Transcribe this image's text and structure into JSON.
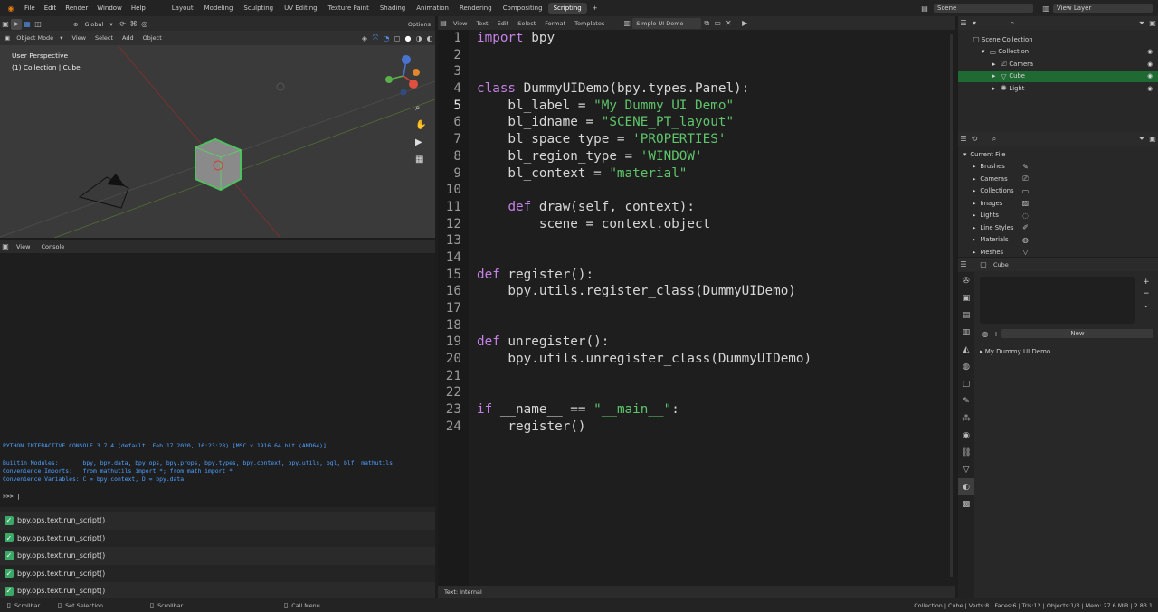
{
  "topbar": {
    "menus": [
      "File",
      "Edit",
      "Render",
      "Window",
      "Help"
    ],
    "workspaces": [
      "Layout",
      "Modeling",
      "Sculpting",
      "UV Editing",
      "Texture Paint",
      "Shading",
      "Animation",
      "Rendering",
      "Compositing",
      "Scripting"
    ],
    "active_workspace": "Scripting",
    "scene": "Scene",
    "view_layer": "View Layer"
  },
  "viewport": {
    "transform": "Global",
    "options": "Options",
    "mode": "Object Mode",
    "menus": [
      "View",
      "Select",
      "Add",
      "Object"
    ],
    "perspective": "User Perspective",
    "collection_info": "(1) Collection | Cube",
    "gizmo": {
      "x": "X",
      "y": "Y",
      "z": "Z"
    }
  },
  "console": {
    "menus": [
      "View",
      "Console"
    ],
    "banner": "PYTHON INTERACTIVE CONSOLE 3.7.4 (default, Feb 17 2020, 16:23:28) [MSC v.1916 64 bit (AMD64)]",
    "builtin": "Builtin Modules:       bpy, bpy.data, bpy.ops, bpy.props, bpy.types, bpy.context, bpy.utils, bgl, blf, mathutils",
    "imports": "Convenience Imports:   from mathutils import *; from math import *",
    "variables": "Convenience Variables: C = bpy.context, D = bpy.data",
    "prompt": ">>> "
  },
  "info_log": [
    "bpy.ops.text.run_script()",
    "bpy.ops.text.run_script()",
    "bpy.ops.text.run_script()",
    "bpy.ops.text.run_script()",
    "bpy.ops.text.run_script()"
  ],
  "text_editor": {
    "menus": [
      "View",
      "Text",
      "Edit",
      "Select",
      "Format",
      "Templates"
    ],
    "file_name": "Simple UI Demo",
    "footer": "Text: Internal",
    "current_line": 5,
    "lines": [
      [
        {
          "t": "import",
          "c": "kw"
        },
        {
          "t": " bpy"
        }
      ],
      [],
      [],
      [
        {
          "t": "class",
          "c": "kw"
        },
        {
          "t": " DummyUIDemo(bpy.types.Panel):"
        }
      ],
      [
        {
          "t": "    bl_label = "
        },
        {
          "t": "\"My Dummy UI Demo\"",
          "c": "str"
        }
      ],
      [
        {
          "t": "    bl_idname = "
        },
        {
          "t": "\"SCENE_PT_layout\"",
          "c": "str"
        }
      ],
      [
        {
          "t": "    bl_space_type = "
        },
        {
          "t": "'PROPERTIES'",
          "c": "str"
        }
      ],
      [
        {
          "t": "    bl_region_type = "
        },
        {
          "t": "'WINDOW'",
          "c": "str"
        }
      ],
      [
        {
          "t": "    bl_context = "
        },
        {
          "t": "\"material\"",
          "c": "str"
        }
      ],
      [],
      [
        {
          "t": "    "
        },
        {
          "t": "def",
          "c": "kw"
        },
        {
          "t": " draw(self, context):"
        }
      ],
      [
        {
          "t": "        scene = context.object"
        }
      ],
      [],
      [],
      [
        {
          "t": "def",
          "c": "kw"
        },
        {
          "t": " register():"
        }
      ],
      [
        {
          "t": "    bpy.utils.register_class(DummyUIDemo)"
        }
      ],
      [],
      [],
      [
        {
          "t": "def",
          "c": "kw"
        },
        {
          "t": " unregister():"
        }
      ],
      [
        {
          "t": "    bpy.utils.unregister_class(DummyUIDemo)"
        }
      ],
      [],
      [],
      [
        {
          "t": "if",
          "c": "kw"
        },
        {
          "t": " __name__ == "
        },
        {
          "t": "\"__main__\"",
          "c": "str"
        },
        {
          "t": ":"
        }
      ],
      [
        {
          "t": "    register()"
        }
      ]
    ]
  },
  "outliner": {
    "root": "Scene Collection",
    "items": [
      {
        "label": "Collection",
        "level": 1
      },
      {
        "label": "Camera",
        "level": 2
      },
      {
        "label": "Cube",
        "level": 2,
        "selected": true
      },
      {
        "label": "Light",
        "level": 2
      }
    ]
  },
  "data_browser": {
    "root": "Current File",
    "items": [
      "Brushes",
      "Cameras",
      "Collections",
      "Images",
      "Lights",
      "Line Styles",
      "Materials",
      "Meshes"
    ]
  },
  "properties": {
    "object": "Cube",
    "new_label": "New",
    "panel": "My Dummy UI Demo"
  },
  "statusbar": {
    "left": [
      "Scrollbar",
      "Set Selection",
      "Scrollbar",
      "Call Menu"
    ],
    "stats": "Collection | Cube | Verts:8 | Faces:6 | Tris:12 | Objects:1/3 | Mem: 27.6 MiB | 2.83.1"
  },
  "colors": {
    "selection": "#1f6a33",
    "keyword": "#c481e6",
    "string": "#5ec46a",
    "console_text": "#4fa0ff"
  }
}
